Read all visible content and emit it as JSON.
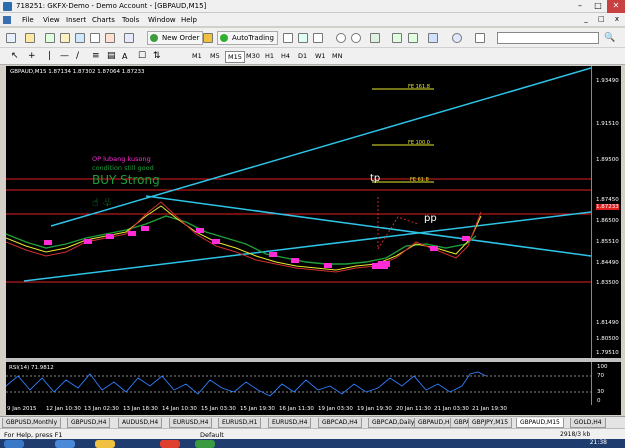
{
  "window": {
    "title": "718251: GKFX-Demo - Demo Account - [GBPAUD,M15]",
    "minimize": "–",
    "maximize": "□",
    "close": "✕"
  },
  "menu": {
    "items": [
      "File",
      "View",
      "Insert",
      "Charts",
      "Tools",
      "Window",
      "Help"
    ],
    "mdi_buttons": "_ □ x"
  },
  "toolbar": {
    "new_order": "New Order",
    "autotrading": "AutoTrading",
    "timeframes": [
      "M1",
      "M5",
      "M15",
      "M30",
      "H1",
      "H4",
      "D1",
      "W1",
      "MN"
    ],
    "active_timeframe": "M15",
    "search_value": ""
  },
  "chart": {
    "header": "GBPAUD,M15  1.87134 1.87302 1.87064 1.87233",
    "annotations": {
      "op": "OP lubang kusong",
      "condition": "condition still good",
      "buy": "BUY Strong",
      "tp": "tp",
      "pp": "pp"
    },
    "fibo": [
      "FE 161.8",
      "FE 100.0",
      "FE 61.8"
    ],
    "price_labels": [
      "1.93490",
      "1.91510",
      "1.89500",
      "1.87450",
      "1.87233",
      "1.86500",
      "1.85510",
      "1.84490",
      "1.83500",
      "1.81490",
      "1.80500",
      "1.79510"
    ],
    "colors": {
      "trend": "#2ec4e8",
      "level": "#e02020",
      "arrows": "#ff2bd6",
      "fibo": "#e8e830"
    }
  },
  "rsi": {
    "label": "RSI(14) 71.9812",
    "levels": [
      "100",
      "70",
      "30",
      "0"
    ]
  },
  "time_axis": [
    "9 Jan 2015",
    "12 Jan 10:30",
    "13 Jan 02:30",
    "13 Jan 18:30",
    "14 Jan 10:30",
    "15 Jan 03:30",
    "15 Jan 19:30",
    "16 Jan 11:30",
    "19 Jan 03:30",
    "19 Jan 19:30",
    "20 Jan 11:30",
    "21 Jan 03:30",
    "21 Jan 19:30"
  ],
  "tabs": [
    "GBPUSD,Monthly",
    "GBPUSD,H4",
    "AUDUSD,H4",
    "EURUSD,H4",
    "EURUSD,H1",
    "EURUSD,H4",
    "GBPCAD,H4",
    "GBPCAD,Daily",
    "GBPAUD,H4",
    "GBPAUD,H4",
    "GBPJPY,M15",
    "GBPAUD,M15",
    "GOLD,H4"
  ],
  "active_tab": 11,
  "status": {
    "help": "For Help, press F1",
    "profile": "Default",
    "traffic": "2918/3 kb"
  },
  "clock": "21:38"
}
